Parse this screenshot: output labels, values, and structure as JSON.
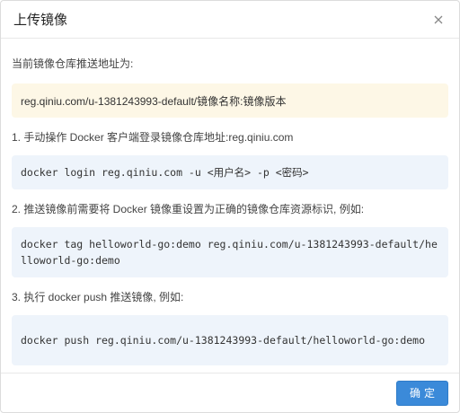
{
  "dialog": {
    "title": "上传镜像",
    "close_icon": "close-icon"
  },
  "body": {
    "address_label": "当前镜像仓库推送地址为:",
    "address_value": "reg.qiniu.com/u-1381243993-default/镜像名称:镜像版本",
    "steps": [
      {
        "label": "1. 手动操作 Docker 客户端登录镜像仓库地址:reg.qiniu.com",
        "code": "docker login reg.qiniu.com -u <用户名> -p <密码>"
      },
      {
        "label": "2. 推送镜像前需要将 Docker 镜像重设置为正确的镜像仓库资源标识, 例如:",
        "code": "docker tag helloworld-go:demo reg.qiniu.com/u-1381243993-default/helloworld-go:demo"
      },
      {
        "label": "3. 执行 docker push 推送镜像, 例如:",
        "code": "docker push reg.qiniu.com/u-1381243993-default/helloworld-go:demo"
      }
    ]
  },
  "footer": {
    "ok_label": "确定"
  },
  "colors": {
    "primary_button": "#3b8ad9",
    "address_bg": "#fdf7e6",
    "code_bg": "#eef4fb"
  }
}
